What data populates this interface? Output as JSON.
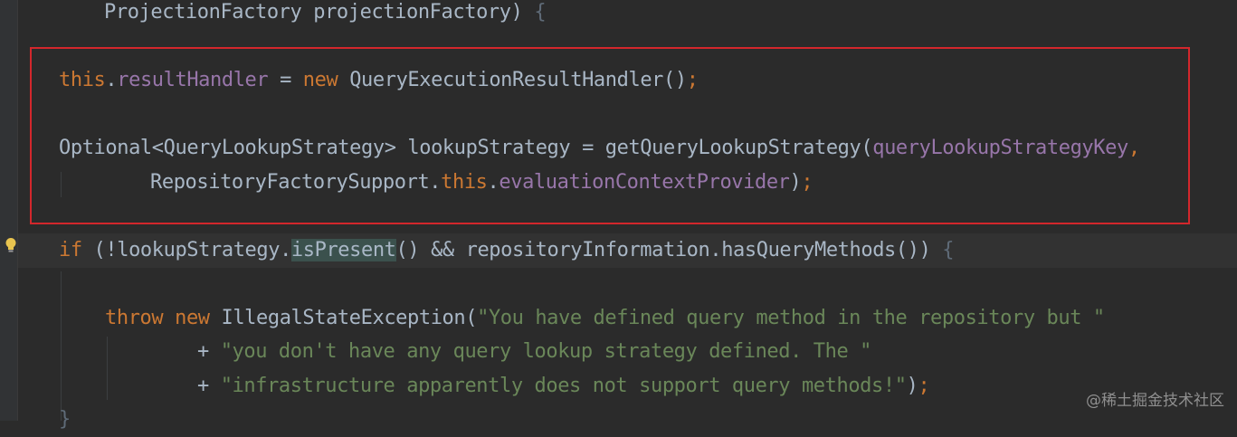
{
  "code": {
    "line_signature": {
      "type": "ProjectionFactory",
      "param": "projectionFactory",
      "close": ")",
      "brace": "{"
    },
    "line_result_handler": {
      "this": "this",
      "dot": ".",
      "field": "resultHandler",
      "assign": " = ",
      "new": "new",
      "ctor": " QueryExecutionResultHandler",
      "parens": "()",
      "semi": ";"
    },
    "line_optional": {
      "type": "Optional",
      "lt": "<",
      "generic": "QueryLookupStrategy",
      "gt": ">",
      "rest": " lookupStrategy = getQueryLookupStrategy",
      "open": "(",
      "field": "queryLookupStrategyKey",
      "comma": ","
    },
    "line_repo_support": {
      "cls": "RepositoryFactorySupport.",
      "this": "this",
      "dot": ".",
      "field": "evaluationContextProvider",
      "close": ")",
      "semi": ";"
    },
    "line_if": {
      "if": "if",
      "open": " (!lookupStrategy.",
      "method": "isPresent",
      "parens": "()",
      "rest": " && repositoryInformation.hasQueryMethods",
      "close_parens": "())",
      "brace": "{"
    },
    "line_throw": {
      "throw": "throw",
      "new": "new",
      "cls": " IllegalStateException",
      "open": "(",
      "str": "\"You have defined query method in the repository but \""
    },
    "line_concat1": {
      "plus": "+ ",
      "str": "\"you don't have any query lookup strategy defined. The \""
    },
    "line_concat2": {
      "plus": "+ ",
      "str": "\"infrastructure apparently does not support query methods!\"",
      "close": ")",
      "semi": ";"
    },
    "line_close_brace": {
      "brace": "}"
    }
  },
  "watermark": "@稀土掘金技术社区",
  "colors": {
    "background": "#2b2b2b",
    "keyword": "#cc7832",
    "field": "#9876aa",
    "string": "#6a8759",
    "text": "#a9b7c6",
    "highlight_box": "#d3272c"
  }
}
